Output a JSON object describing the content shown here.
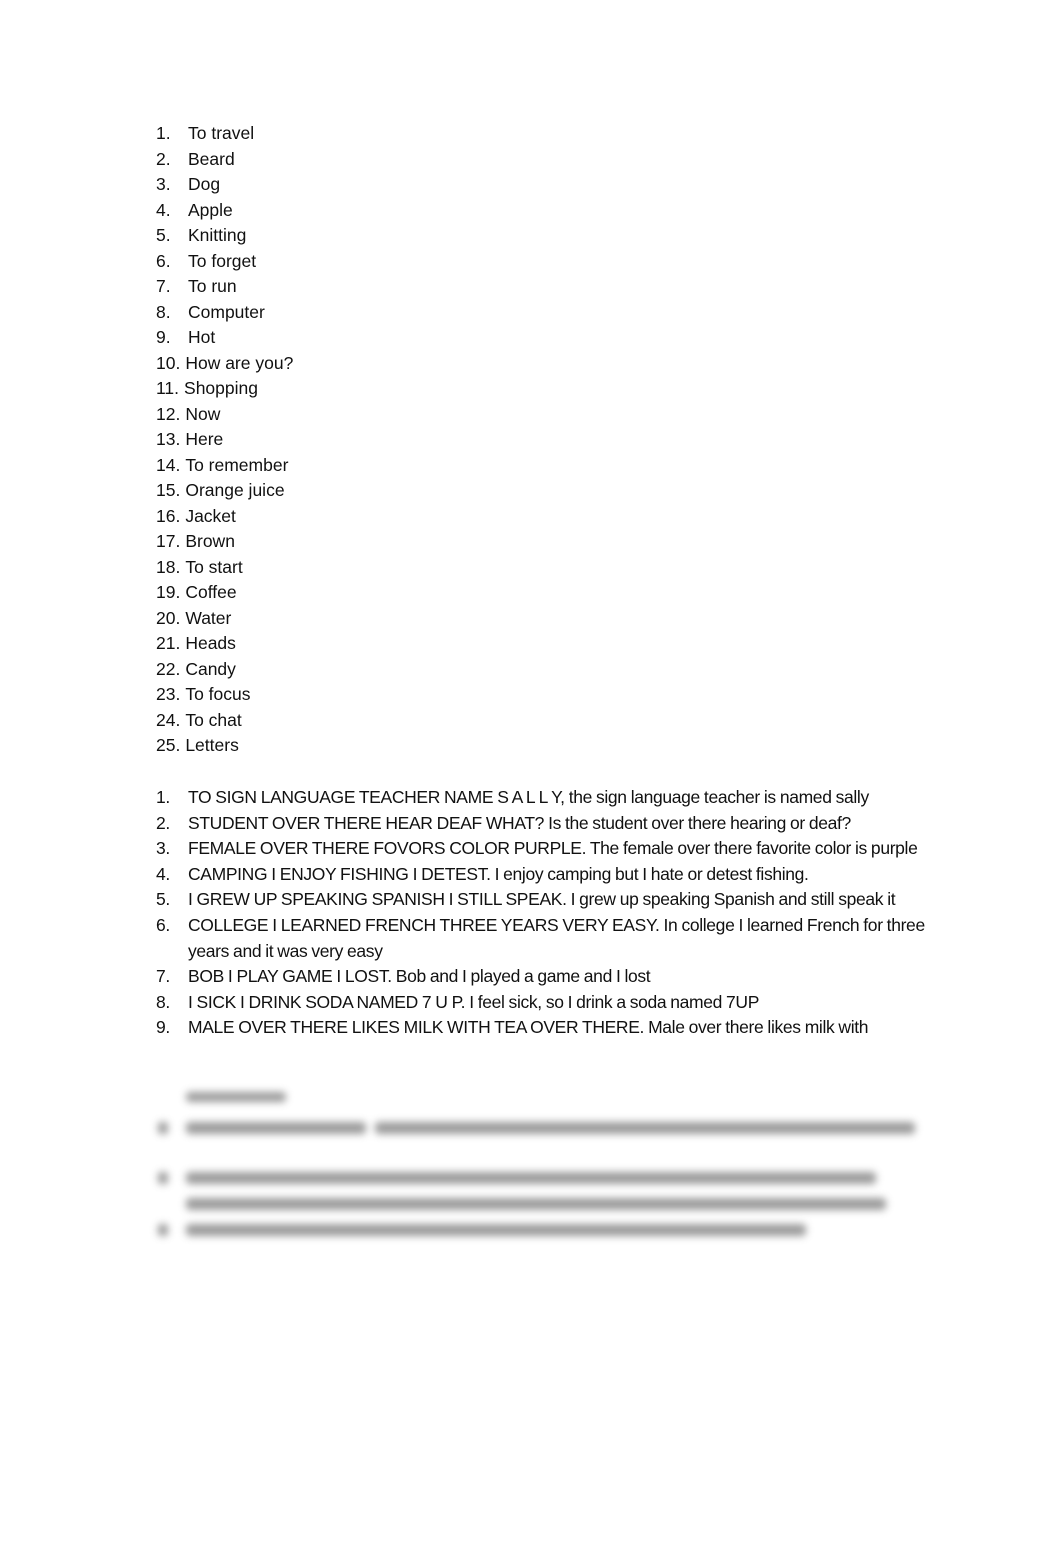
{
  "vocabulary": [
    {
      "num": "1.",
      "text": "To travel"
    },
    {
      "num": "2.",
      "text": "Beard"
    },
    {
      "num": "3.",
      "text": "Dog"
    },
    {
      "num": "4.",
      "text": "Apple"
    },
    {
      "num": "5.",
      "text": "Knitting"
    },
    {
      "num": "6.",
      "text": "To forget"
    },
    {
      "num": "7.",
      "text": "To run"
    },
    {
      "num": "8.",
      "text": "Computer"
    },
    {
      "num": "9.",
      "text": "Hot"
    },
    {
      "num": "10.",
      "text": "How are you?"
    },
    {
      "num": "11.",
      "text": "Shopping"
    },
    {
      "num": "12.",
      "text": "Now"
    },
    {
      "num": "13.",
      "text": "Here"
    },
    {
      "num": "14.",
      "text": "To remember"
    },
    {
      "num": "15.",
      "text": "Orange juice"
    },
    {
      "num": "16.",
      "text": "Jacket"
    },
    {
      "num": "17.",
      "text": "Brown"
    },
    {
      "num": "18.",
      "text": "To start"
    },
    {
      "num": "19.",
      "text": "Coffee"
    },
    {
      "num": "20.",
      "text": "Water"
    },
    {
      "num": "21.",
      "text": "Heads"
    },
    {
      "num": "22.",
      "text": "Candy"
    },
    {
      "num": "23.",
      "text": "To focus"
    },
    {
      "num": "24.",
      "text": "To chat"
    },
    {
      "num": "25.",
      "text": "Letters"
    }
  ],
  "sentences": [
    {
      "num": "1.",
      "text": "TO SIGN LANGUAGE TEACHER NAME S A L L Y, the sign language teacher is named sally"
    },
    {
      "num": "2.",
      "text": "STUDENT OVER THERE HEAR DEAF WHAT? Is the student over there hearing or deaf?"
    },
    {
      "num": "3.",
      "text": "FEMALE OVER THERE FOVORS COLOR PURPLE. The female over there favorite color is purple"
    },
    {
      "num": "4.",
      "text": "CAMPING I ENJOY FISHING I DETEST. I enjoy camping but I hate or detest fishing."
    },
    {
      "num": "5.",
      "text": "I GREW UP SPEAKING SPANISH I STILL SPEAK. I grew up speaking Spanish and still speak it"
    },
    {
      "num": "6.",
      "text": "COLLEGE I LEARNED FRENCH THREE YEARS VERY EASY. In college I learned French for three years and it was very easy"
    },
    {
      "num": "7.",
      "text": "BOB I PLAY GAME I LOST. Bob and I played a game and I lost"
    },
    {
      "num": "8.",
      "text": "I SICK I DRINK SODA NAMED 7 U P. I feel sick, so I drink a soda named 7UP"
    },
    {
      "num": "9.",
      "text": "MALE OVER THERE LIKES MILK WITH TEA OVER THERE. Male over there likes milk with"
    }
  ],
  "blurred_preview": {
    "note": "remaining content obscured"
  }
}
